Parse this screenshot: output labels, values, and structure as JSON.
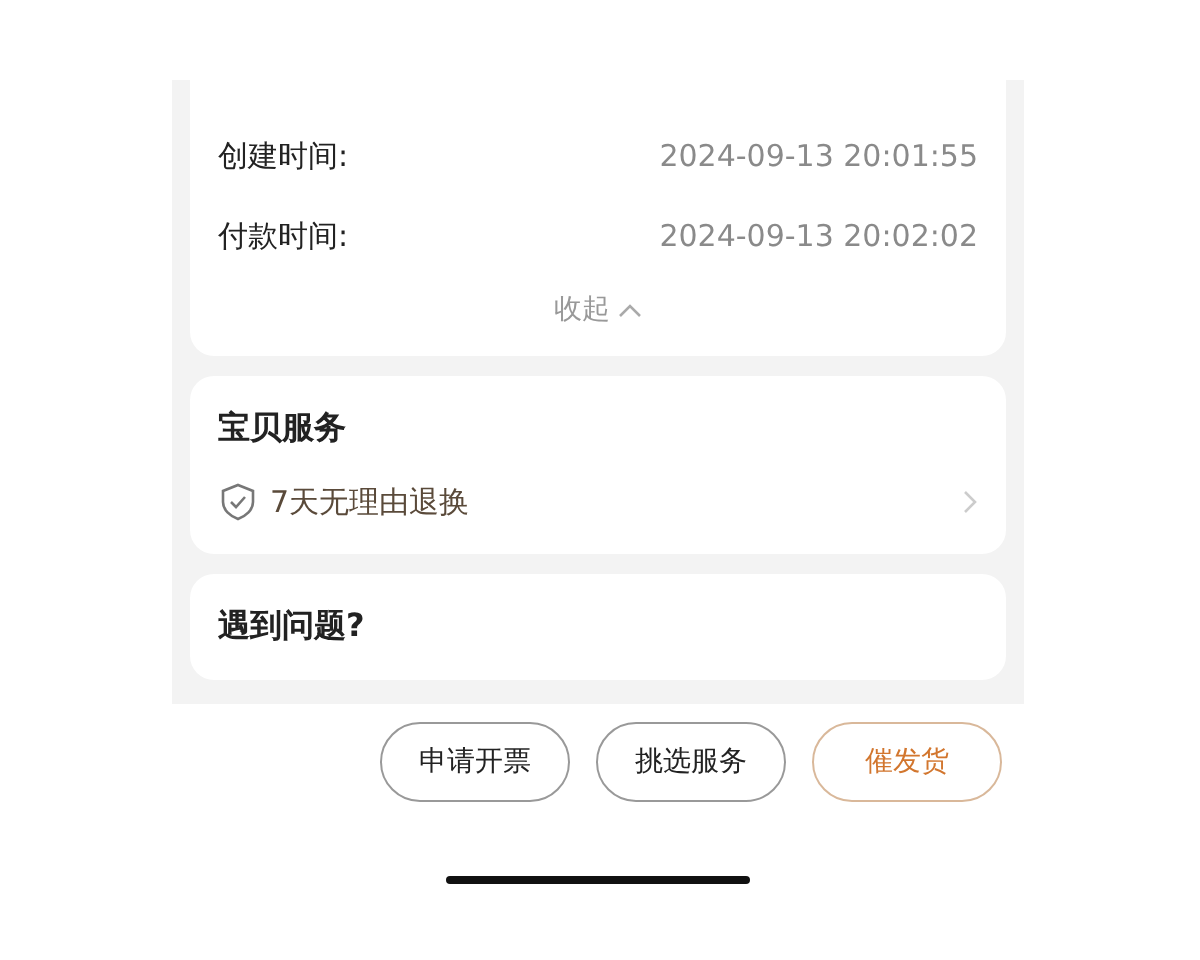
{
  "order_info": {
    "rows": [
      {
        "label": "创建时间:",
        "value": "2024-09-13 20:01:55"
      },
      {
        "label": "付款时间:",
        "value": "2024-09-13 20:02:02"
      }
    ],
    "collapse": "收起"
  },
  "service": {
    "title": "宝贝服务",
    "items": [
      {
        "label": "7天无理由退换"
      }
    ]
  },
  "help": {
    "title": "遇到问题?"
  },
  "actions": [
    {
      "label": "申请开票",
      "kind": "outline"
    },
    {
      "label": "挑选服务",
      "kind": "outline"
    },
    {
      "label": "催发货",
      "kind": "accent"
    }
  ]
}
